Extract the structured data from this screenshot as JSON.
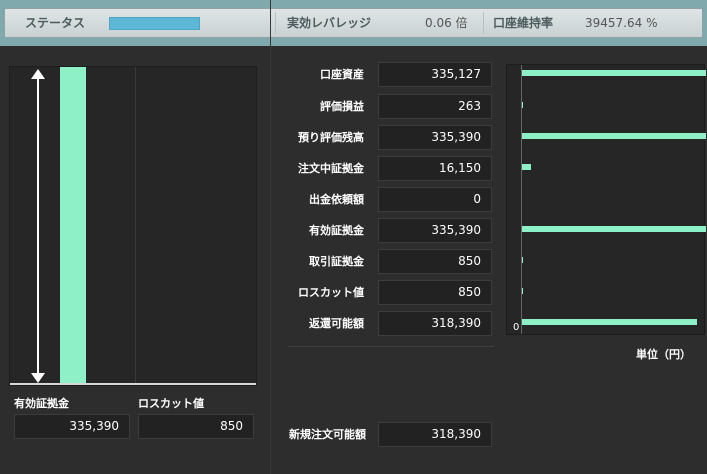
{
  "status_bar": {
    "status_label": "ステータス",
    "status_progress": 0.44,
    "leverage_label": "実効レバレッジ",
    "leverage_value": "0.06 倍",
    "margin_rate_label": "口座維持率",
    "margin_rate_value": "39457.64 %"
  },
  "left_chart": {
    "effective_margin_label": "有効証拠金",
    "effective_margin_value": "335,390",
    "losscut_label": "ロスカット値",
    "losscut_value": "850"
  },
  "rows": [
    {
      "label": "口座資産",
      "value": "335,127"
    },
    {
      "label": "評価損益",
      "value": "263"
    },
    {
      "label": "預り評価残高",
      "value": "335,390"
    },
    {
      "label": "注文中証拠金",
      "value": "16,150"
    },
    {
      "label": "出金依頼額",
      "value": "0"
    },
    {
      "label": "有効証拠金",
      "value": "335,390"
    },
    {
      "label": "取引証拠金",
      "value": "850"
    },
    {
      "label": "ロスカット値",
      "value": "850"
    },
    {
      "label": "返還可能額",
      "value": "318,390"
    }
  ],
  "new_order": {
    "label": "新規注文可能額",
    "value": "318,390"
  },
  "right_chart": {
    "zero_label": "0",
    "unit_label": "単位（円）",
    "bar_values": [
      335127,
      263,
      335390,
      16150,
      0,
      335390,
      850,
      850,
      318390
    ]
  },
  "colors": {
    "bar": "#8ef0c6",
    "status_fill": "#5db7d6",
    "header_bg": "#7fa9ad"
  }
}
